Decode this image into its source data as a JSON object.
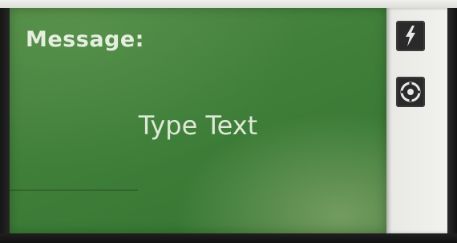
{
  "message": {
    "label": "Message:",
    "text": "Type Text"
  },
  "side_buttons": [
    {
      "icon": "lightning-icon"
    },
    {
      "icon": "target-icon"
    }
  ],
  "colors": {
    "panel_green": "#3f7f3a",
    "text_light": "#e6eee0",
    "button_dark": "#2a2a2a",
    "side_panel": "#ececE8"
  }
}
